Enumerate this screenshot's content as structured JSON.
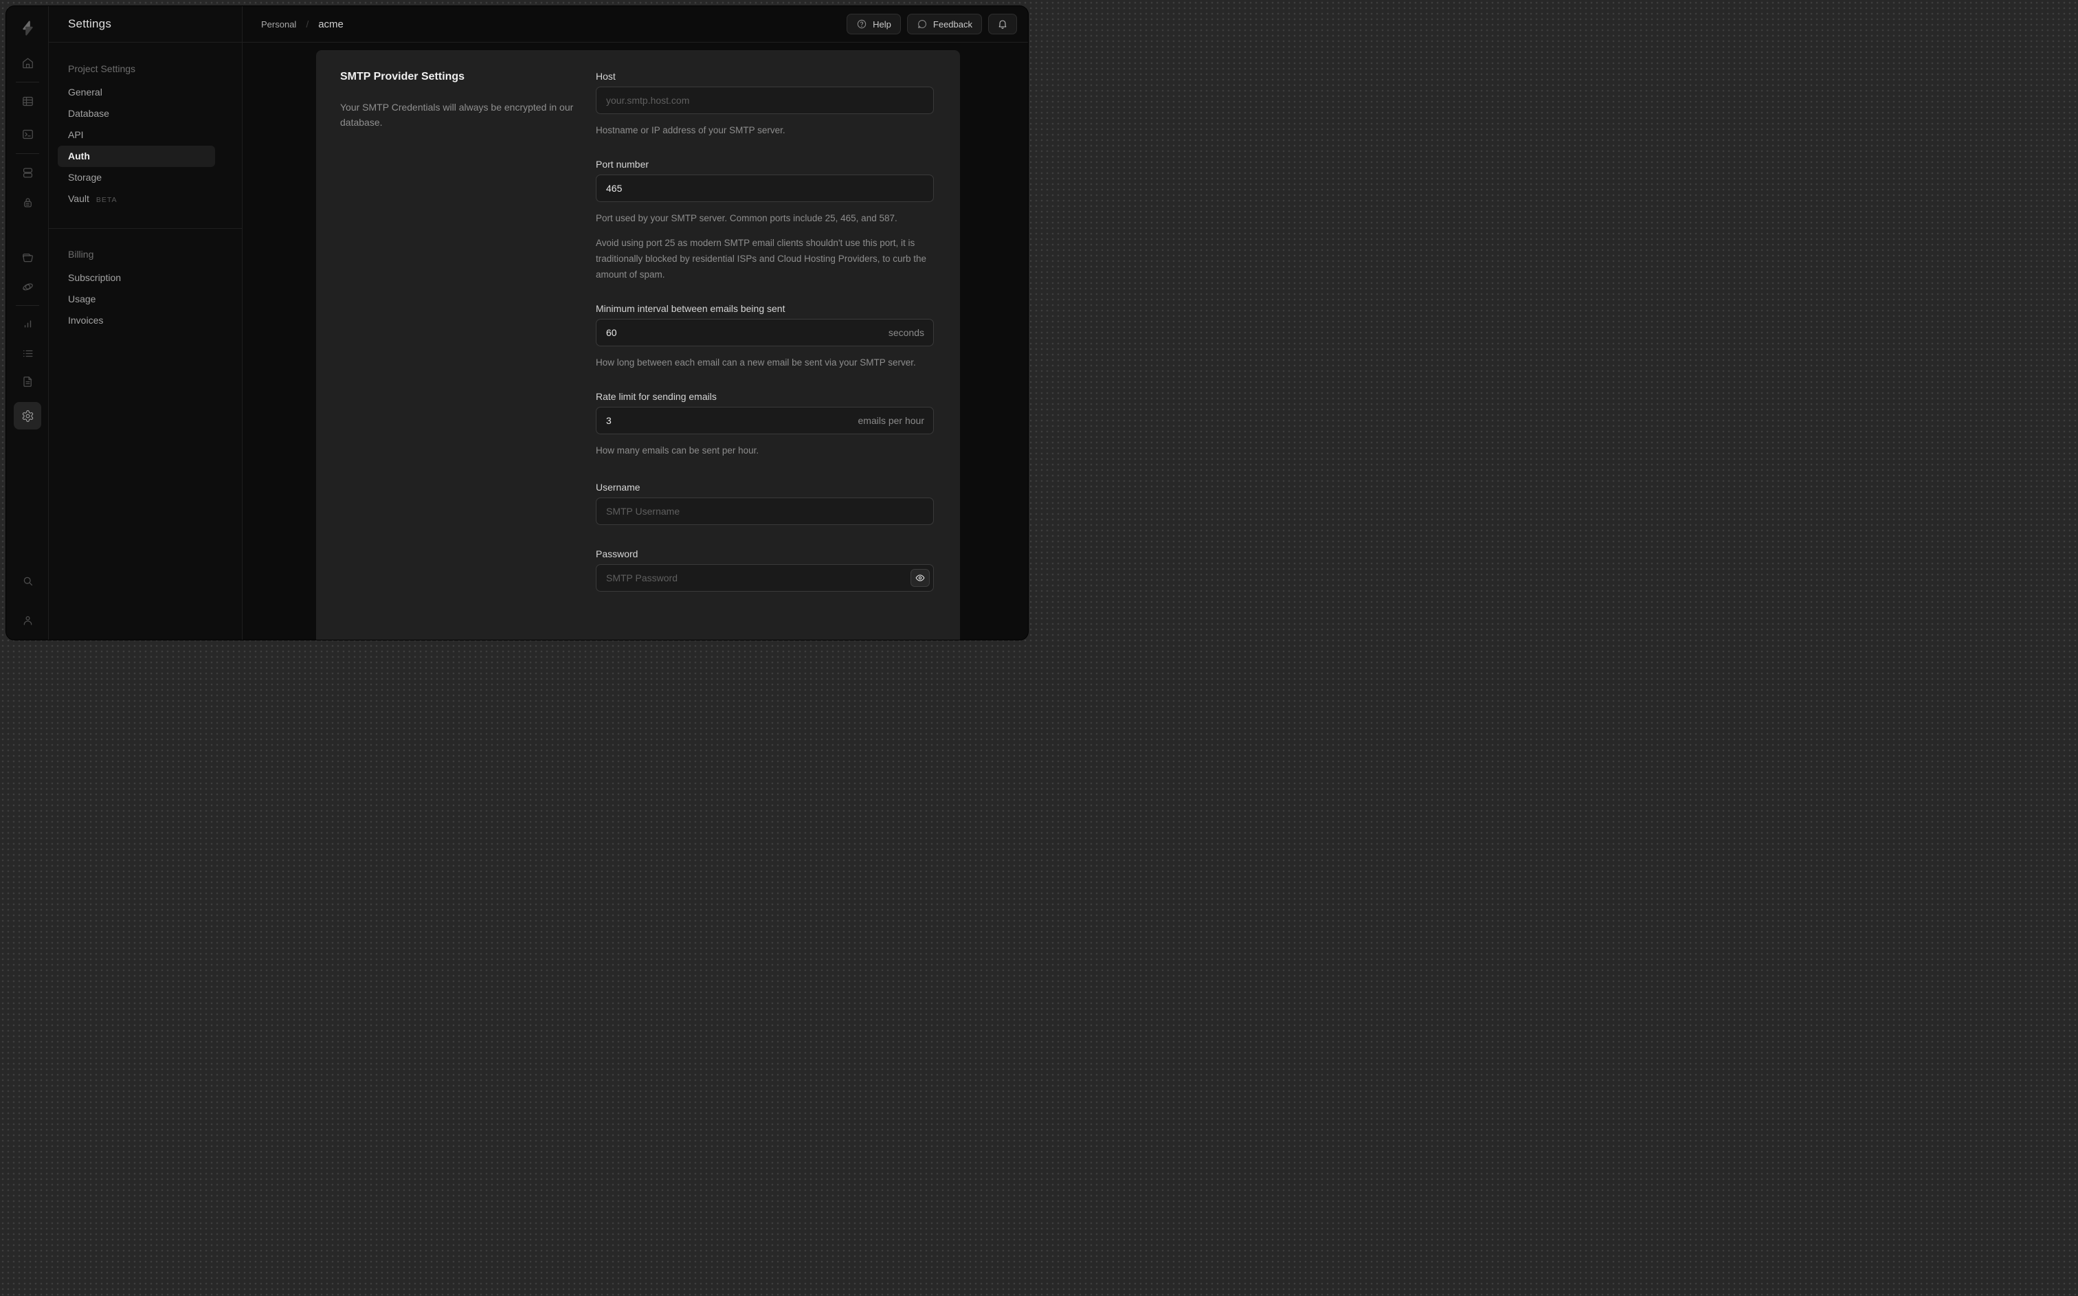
{
  "sidebar_rail": {
    "icons": [
      "supabase-logo",
      "home",
      "table-editor",
      "sql-editor",
      "database",
      "auth",
      "storage",
      "edge-functions",
      "reports",
      "logs",
      "docs",
      "settings",
      "search",
      "user"
    ],
    "active_icon": "settings"
  },
  "settings_nav": {
    "title": "Settings",
    "sections": [
      {
        "heading": "Project Settings",
        "items": [
          {
            "label": "General"
          },
          {
            "label": "Database"
          },
          {
            "label": "API"
          },
          {
            "label": "Auth",
            "active": true
          },
          {
            "label": "Storage"
          },
          {
            "label": "Vault",
            "badge": "BETA"
          }
        ]
      },
      {
        "heading": "Billing",
        "items": [
          {
            "label": "Subscription"
          },
          {
            "label": "Usage"
          },
          {
            "label": "Invoices"
          }
        ]
      }
    ]
  },
  "header": {
    "breadcrumb": {
      "org": "Personal",
      "separator": "/",
      "project": "acme"
    },
    "help_label": "Help",
    "feedback_label": "Feedback"
  },
  "main": {
    "section": {
      "title": "SMTP Provider Settings",
      "description": "Your SMTP Credentials will always be encrypted in our database."
    },
    "fields": {
      "host": {
        "label": "Host",
        "placeholder": "your.smtp.host.com",
        "value": "",
        "help": "Hostname or IP address of your SMTP server."
      },
      "port": {
        "label": "Port number",
        "value": "465",
        "help": "Port used by your SMTP server. Common ports include 25, 465, and 587.",
        "note": "Avoid using port 25 as modern SMTP email clients shouldn't use this port, it is traditionally blocked by residential ISPs and Cloud Hosting Providers, to curb the amount of spam."
      },
      "min_interval": {
        "label": "Minimum interval between emails being sent",
        "value": "60",
        "suffix": "seconds",
        "help": "How long between each email can a new email be sent via your SMTP server."
      },
      "rate_limit": {
        "label": "Rate limit for sending emails",
        "value": "3",
        "suffix": "emails per hour",
        "help": "How many emails can be sent per hour."
      },
      "username": {
        "label": "Username",
        "placeholder": "SMTP Username",
        "value": ""
      },
      "password": {
        "label": "Password",
        "placeholder": "SMTP Password",
        "value": ""
      }
    }
  },
  "colors": {
    "desktop": "#282828",
    "app_background": "#0d0d0d",
    "panel": "#212121",
    "input_background": "#1a1a1a",
    "input_border": "#3a3a3a",
    "border": "#1f1f1f",
    "text_primary": "#ededed",
    "text_muted": "#8d8d8d",
    "placeholder": "#5f5f5f"
  }
}
